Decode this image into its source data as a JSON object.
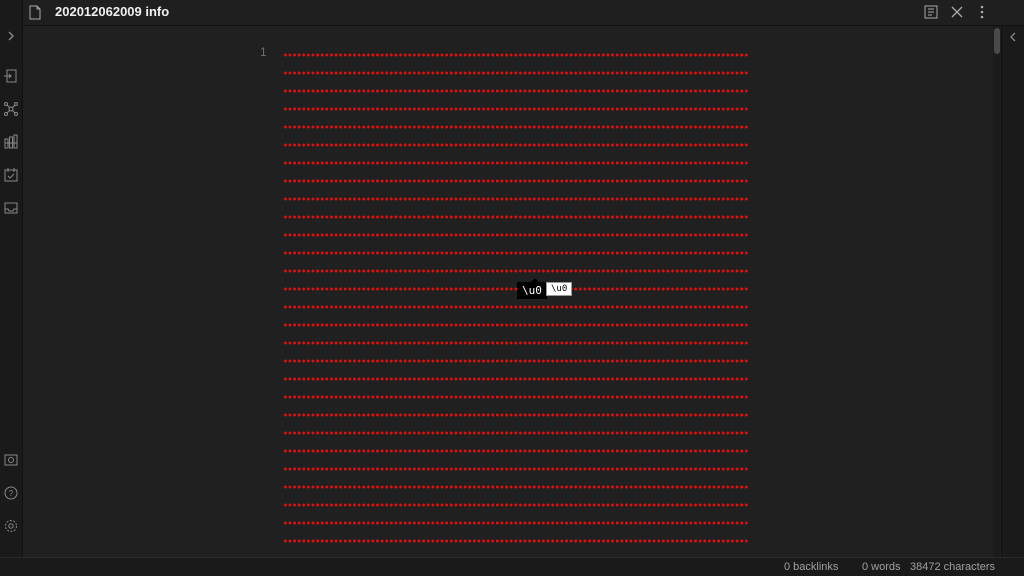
{
  "header": {
    "title": "202012062009 info",
    "icons": [
      "file-icon",
      "reading-view-icon",
      "close-icon",
      "more-options-icon"
    ]
  },
  "ribbon": {
    "icons": [
      "expand-sidebar-icon",
      "quick-switcher-icon",
      "graph-view-icon",
      "kanban-icon",
      "daily-note-icon",
      "inbox-icon",
      "vault-icon",
      "help-icon",
      "settings-icon"
    ]
  },
  "editor": {
    "line_number": "1",
    "tooltip_dark": "\\u0",
    "tooltip_light": "\\u0",
    "dot_color": "#e01010"
  },
  "status": {
    "backlinks": "0 backlinks",
    "words": "0 words",
    "characters": "38472 characters"
  }
}
